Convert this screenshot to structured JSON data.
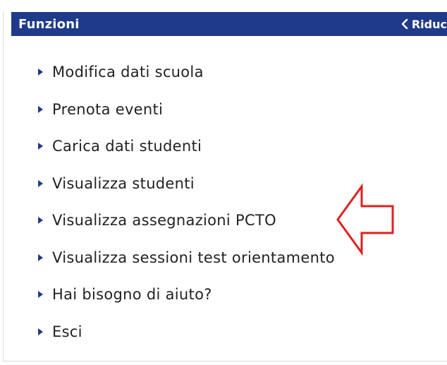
{
  "header": {
    "title": "Funzioni",
    "collapse_label": "Riduc",
    "background": "#1f3a8a"
  },
  "menu": {
    "items": [
      {
        "label": "Modifica dati scuola",
        "icon": "triangle-right-icon"
      },
      {
        "label": "Prenota eventi",
        "icon": "triangle-right-icon"
      },
      {
        "label": "Carica dati studenti",
        "icon": "triangle-right-icon"
      },
      {
        "label": "Visualizza studenti",
        "icon": "triangle-right-icon"
      },
      {
        "label": "Visualizza assegnazioni PCTO",
        "icon": "triangle-right-icon"
      },
      {
        "label": "Visualizza sessioni test orientamento",
        "icon": "triangle-right-icon"
      },
      {
        "label": "Hai bisogno di aiuto?",
        "icon": "triangle-right-icon"
      },
      {
        "label": "Esci",
        "icon": "triangle-right-icon"
      }
    ]
  },
  "annotation": {
    "icon": "left-arrow-outline-icon",
    "color": "#e02020"
  }
}
